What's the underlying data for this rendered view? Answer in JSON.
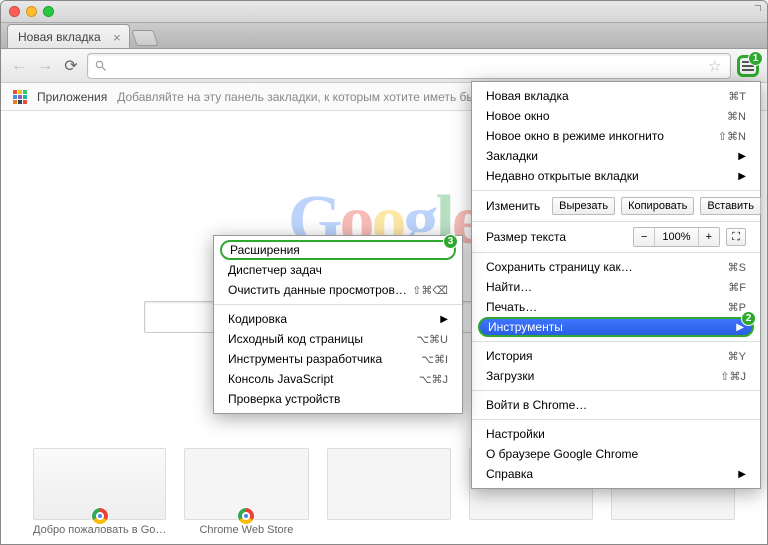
{
  "tab": {
    "title": "Новая вкладка"
  },
  "bookmarkbar": {
    "apps_label": "Приложения",
    "hint": "Добавляйте на эту панель закладки, к которым хотите иметь быстрый дос"
  },
  "main_menu": {
    "new_tab": "Новая вкладка",
    "new_tab_sc": "⌘T",
    "new_window": "Новое окно",
    "new_window_sc": "⌘N",
    "incognito": "Новое окно в режиме инкогнито",
    "incognito_sc": "⇧⌘N",
    "bookmarks": "Закладки",
    "recent_tabs": "Недавно открытые вкладки",
    "edit_label": "Изменить",
    "cut": "Вырезать",
    "copy": "Копировать",
    "paste": "Вставить",
    "zoom_label": "Размер текста",
    "zoom_value": "100%",
    "save_page": "Сохранить страницу как…",
    "save_page_sc": "⌘S",
    "find": "Найти…",
    "find_sc": "⌘F",
    "print": "Печать…",
    "print_sc": "⌘P",
    "tools": "Инструменты",
    "history": "История",
    "history_sc": "⌘Y",
    "downloads": "Загрузки",
    "downloads_sc": "⇧⌘J",
    "signin": "Войти в Chrome…",
    "settings": "Настройки",
    "about": "О браузере Google Chrome",
    "help": "Справка"
  },
  "sub_menu": {
    "extensions": "Расширения",
    "task_manager": "Диспетчер задач",
    "clear_data": "Очистить данные просмотров…",
    "clear_data_sc": "⇧⌘⌫",
    "encoding": "Кодировка",
    "source": "Исходный код страницы",
    "source_sc": "⌥⌘U",
    "devtools": "Инструменты разработчика",
    "devtools_sc": "⌥⌘I",
    "jsconsole": "Консоль JavaScript",
    "jsconsole_sc": "⌥⌘J",
    "inspect_devices": "Проверка устройств"
  },
  "thumbnails": {
    "t1": "Добро пожаловать в Go…",
    "t2": "Chrome Web Store"
  },
  "badges": {
    "menu": "1",
    "tools": "2",
    "extensions": "3"
  }
}
